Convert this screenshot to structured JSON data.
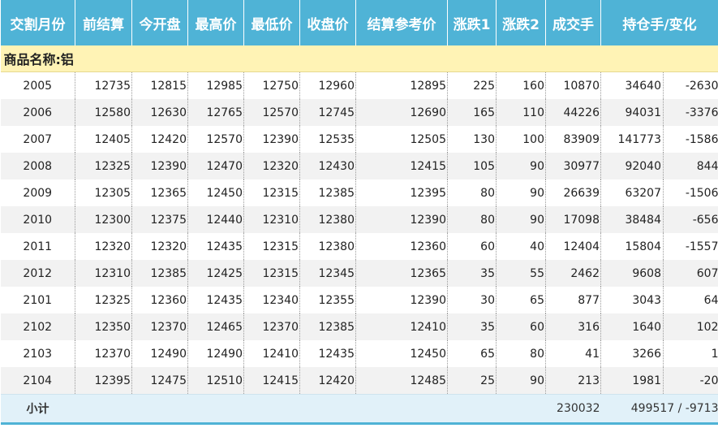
{
  "headers": {
    "month": "交割月份",
    "prev_settle": "前结算",
    "open": "今开盘",
    "high": "最高价",
    "low": "最低价",
    "close": "收盘价",
    "settle_ref": "结算参考价",
    "change1": "涨跌1",
    "change2": "涨跌2",
    "volume": "成交手",
    "open_interest": "持仓手/变化"
  },
  "group_label": "商品名称:铝",
  "rows": [
    {
      "month": "2005",
      "prev_settle": "12735",
      "open": "12815",
      "high": "12985",
      "low": "12750",
      "close": "12960",
      "settle_ref": "12895",
      "change1": "225",
      "change2": "160",
      "volume": "10870",
      "position": "34640",
      "position_change": "-2630"
    },
    {
      "month": "2006",
      "prev_settle": "12580",
      "open": "12630",
      "high": "12765",
      "low": "12570",
      "close": "12745",
      "settle_ref": "12690",
      "change1": "165",
      "change2": "110",
      "volume": "44226",
      "position": "94031",
      "position_change": "-3376"
    },
    {
      "month": "2007",
      "prev_settle": "12405",
      "open": "12420",
      "high": "12570",
      "low": "12390",
      "close": "12535",
      "settle_ref": "12505",
      "change1": "130",
      "change2": "100",
      "volume": "83909",
      "position": "141773",
      "position_change": "-1586"
    },
    {
      "month": "2008",
      "prev_settle": "12325",
      "open": "12390",
      "high": "12470",
      "low": "12320",
      "close": "12430",
      "settle_ref": "12415",
      "change1": "105",
      "change2": "90",
      "volume": "30977",
      "position": "92040",
      "position_change": "844"
    },
    {
      "month": "2009",
      "prev_settle": "12305",
      "open": "12365",
      "high": "12450",
      "low": "12315",
      "close": "12385",
      "settle_ref": "12395",
      "change1": "80",
      "change2": "90",
      "volume": "26639",
      "position": "63207",
      "position_change": "-1506"
    },
    {
      "month": "2010",
      "prev_settle": "12300",
      "open": "12375",
      "high": "12440",
      "low": "12310",
      "close": "12380",
      "settle_ref": "12390",
      "change1": "80",
      "change2": "90",
      "volume": "17098",
      "position": "38484",
      "position_change": "-656"
    },
    {
      "month": "2011",
      "prev_settle": "12320",
      "open": "12320",
      "high": "12435",
      "low": "12315",
      "close": "12380",
      "settle_ref": "12360",
      "change1": "60",
      "change2": "40",
      "volume": "12404",
      "position": "15804",
      "position_change": "-1557"
    },
    {
      "month": "2012",
      "prev_settle": "12310",
      "open": "12385",
      "high": "12425",
      "low": "12315",
      "close": "12345",
      "settle_ref": "12365",
      "change1": "35",
      "change2": "55",
      "volume": "2462",
      "position": "9608",
      "position_change": "607"
    },
    {
      "month": "2101",
      "prev_settle": "12325",
      "open": "12360",
      "high": "12435",
      "low": "12340",
      "close": "12355",
      "settle_ref": "12390",
      "change1": "30",
      "change2": "65",
      "volume": "877",
      "position": "3043",
      "position_change": "64"
    },
    {
      "month": "2102",
      "prev_settle": "12350",
      "open": "12370",
      "high": "12465",
      "low": "12370",
      "close": "12385",
      "settle_ref": "12410",
      "change1": "35",
      "change2": "60",
      "volume": "316",
      "position": "1640",
      "position_change": "102"
    },
    {
      "month": "2103",
      "prev_settle": "12370",
      "open": "12490",
      "high": "12490",
      "low": "12410",
      "close": "12435",
      "settle_ref": "12450",
      "change1": "65",
      "change2": "80",
      "volume": "41",
      "position": "3266",
      "position_change": "1"
    },
    {
      "month": "2104",
      "prev_settle": "12395",
      "open": "12475",
      "high": "12510",
      "low": "12415",
      "close": "12420",
      "settle_ref": "12485",
      "change1": "25",
      "change2": "90",
      "volume": "213",
      "position": "1981",
      "position_change": "-20"
    }
  ],
  "total": {
    "label": "小计",
    "volume": "230032",
    "position": "499517 / -9713"
  },
  "colors": {
    "header_bg": "#4fb3d6",
    "group_bg": "#fff3b5",
    "row_alt_bg": "#f2f2f2",
    "total_bg": "#e1f1f9"
  }
}
